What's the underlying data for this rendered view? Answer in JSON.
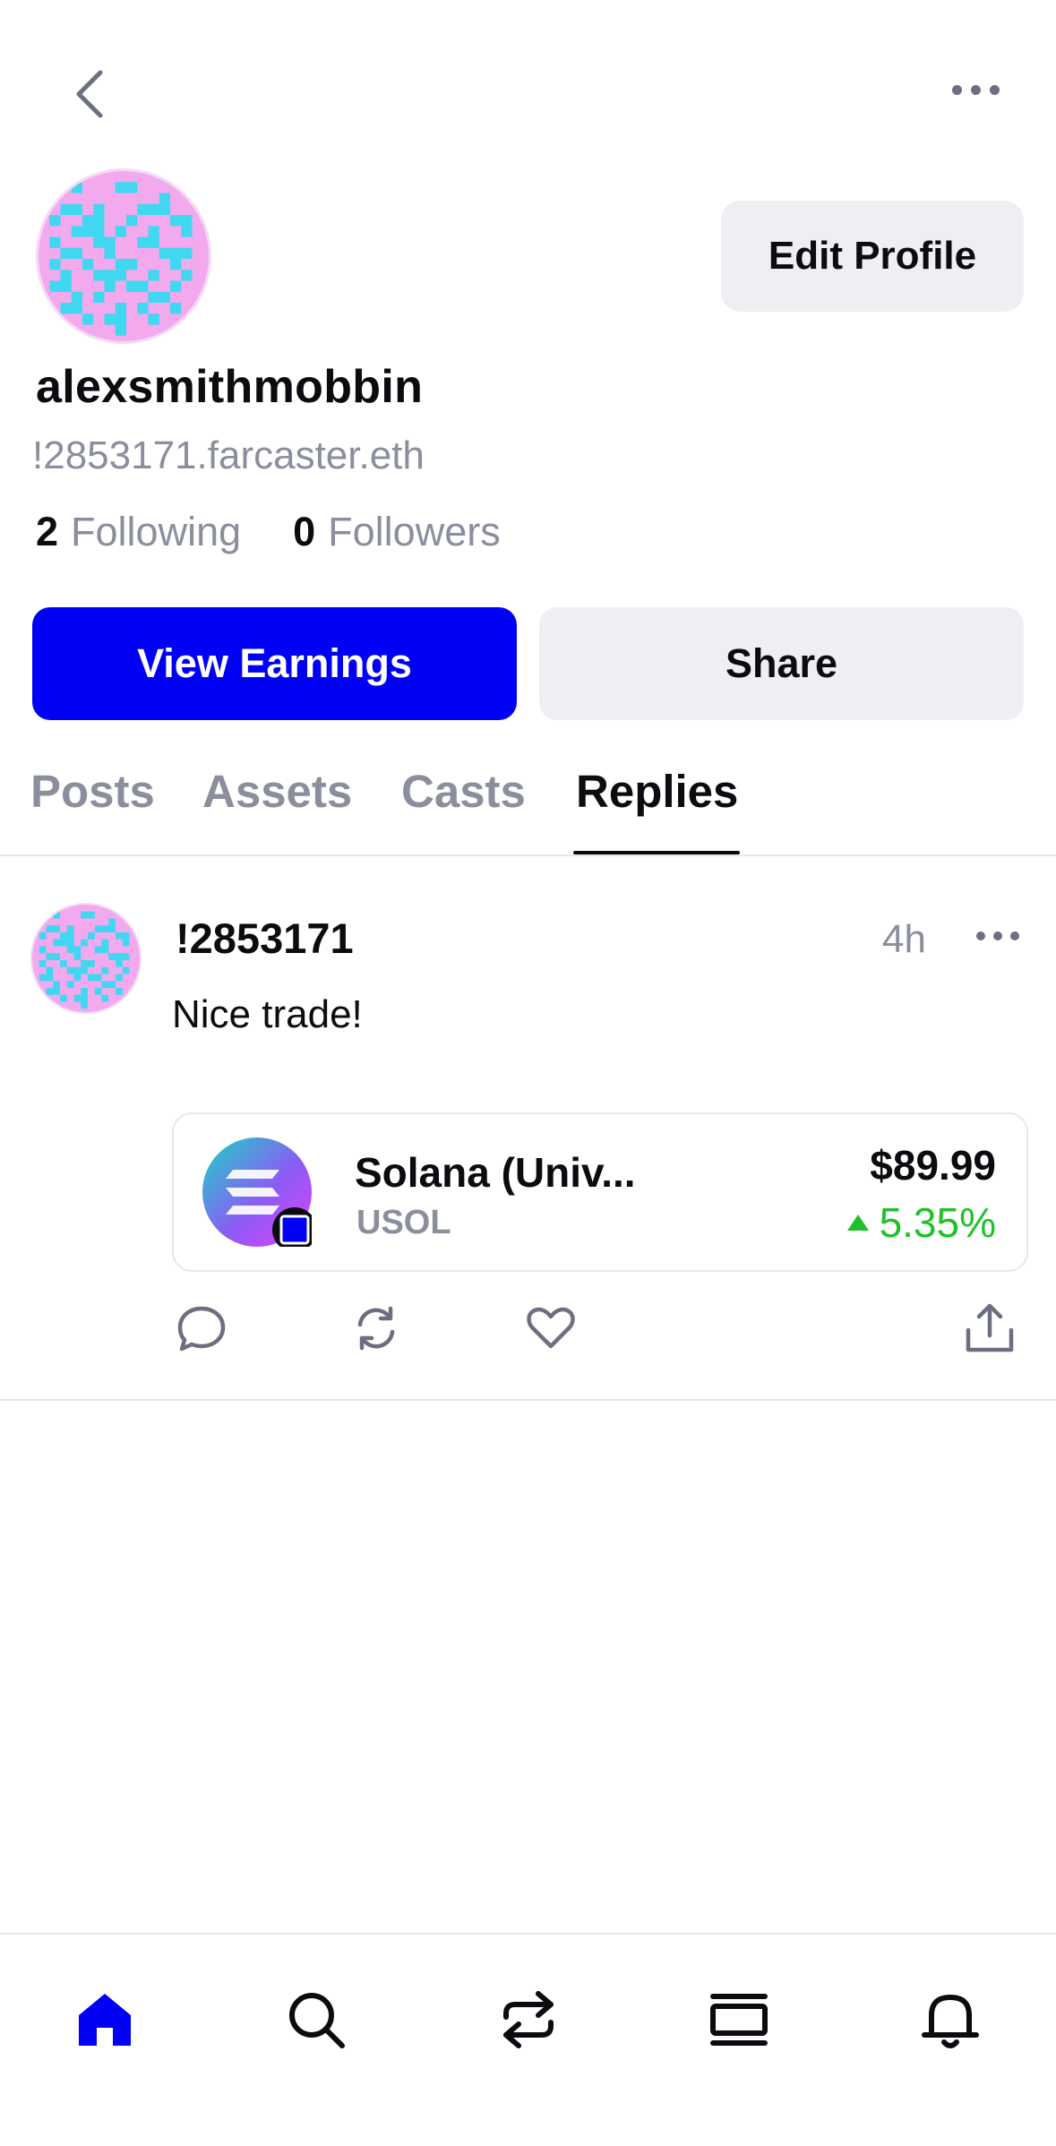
{
  "topbar": {
    "back_icon": "chevron-left-icon",
    "more_icon": "more-horizontal-icon"
  },
  "profile": {
    "username": "alexsmithmobbin",
    "handle": "!2853171.farcaster.eth",
    "following_count": "2",
    "following_label": "Following",
    "followers_count": "0",
    "followers_label": "Followers",
    "edit_label": "Edit Profile",
    "avatar_colors": {
      "background": "#f2a9ee",
      "pixel": "#40d8f0"
    }
  },
  "actions": {
    "earnings_label": "View Earnings",
    "share_label": "Share",
    "accent": "#0000f5"
  },
  "tabs": [
    {
      "label": "Posts",
      "active": false
    },
    {
      "label": "Assets",
      "active": false
    },
    {
      "label": "Casts",
      "active": false
    },
    {
      "label": "Replies",
      "active": true
    }
  ],
  "post": {
    "author": "!2853171",
    "time": "4h",
    "text": "Nice trade!",
    "asset": {
      "name": "Solana (Univ...",
      "ticker": "USOL",
      "price": "$89.99",
      "change": "5.35%",
      "change_color": "#1fc12b"
    },
    "action_icons": [
      "comment-icon",
      "recast-icon",
      "heart-icon",
      "share-upload-icon"
    ]
  },
  "bottom_nav": [
    {
      "icon": "home-icon",
      "active": true
    },
    {
      "icon": "search-icon",
      "active": false
    },
    {
      "icon": "swap-icon",
      "active": false
    },
    {
      "icon": "feed-icon",
      "active": false
    },
    {
      "icon": "bell-icon",
      "active": false
    }
  ]
}
